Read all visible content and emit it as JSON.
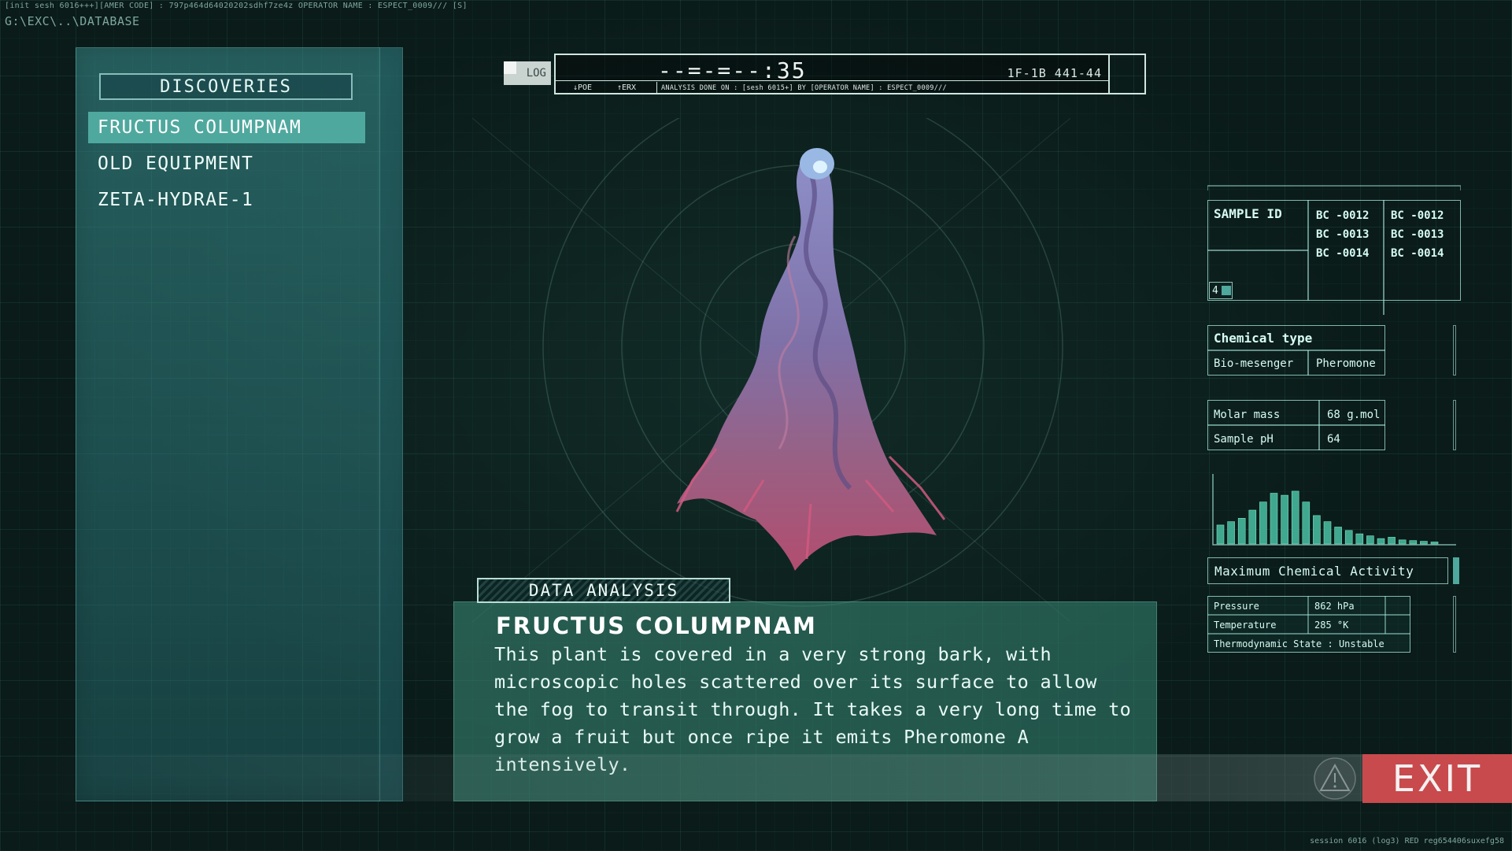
{
  "header": {
    "status_line": "[init sesh 6016+++][AMER CODE] : 797p464d64020202sdhf7ze4z  OPERATOR NAME : ESPECT_0009/// [S]",
    "path": "G:\\EXC\\..\\DATABASE"
  },
  "sidebar": {
    "title": "DISCOVERIES",
    "items": [
      {
        "label": "FRUCTUS COLUMPNAM",
        "selected": true
      },
      {
        "label": "OLD EQUIPMENT",
        "selected": false
      },
      {
        "label": "ZETA-HYDRAE-1",
        "selected": false
      }
    ]
  },
  "log": {
    "tab": "LOG",
    "counter": "--=-=--:35",
    "code": "1F-1B 441-44",
    "poe": "↓POE",
    "erx": "↑ERX",
    "analysis": "ANALYSIS DONE ON : [sesh 6015+] BY [OPERATOR NAME] : ESPECT_0009///"
  },
  "analysis": {
    "tab": "DATA ANALYSIS",
    "title": "FRUCTUS COLUMPNAM",
    "text": "This plant is covered in a very strong bark, with microscopic holes scattered over its surface to allow the fog to transit through. It takes a very long time to grow a fruit but once ripe it emits Pheromone A intensively."
  },
  "right_panel": {
    "sample_label": "SAMPLE ID",
    "sample_ids_col1": [
      "BC -0012",
      "BC -0013",
      "BC -0014"
    ],
    "sample_ids_col2": [
      "BC -0012",
      "BC -0013",
      "BC -0014"
    ],
    "sample_count": "4",
    "chemical_title": "Chemical type",
    "chemical_values": [
      "Bio-mesenger",
      "Pheromone"
    ],
    "molar_label": "Molar mass",
    "molar_value": "68 g.mol",
    "ph_label": "Sample pH",
    "ph_value": "64",
    "histogram": [
      0.28,
      0.33,
      0.38,
      0.5,
      0.62,
      0.75,
      0.72,
      0.78,
      0.62,
      0.42,
      0.33,
      0.25,
      0.2,
      0.15,
      0.12,
      0.08,
      0.1,
      0.06,
      0.05,
      0.04,
      0.03
    ],
    "max_activity": "Maximum Chemical Activity",
    "pressure_label": "Pressure",
    "pressure_value": "862 hPa",
    "temperature_label": "Temperature",
    "temperature_value": "285 °K",
    "thermo_state": "Thermodynamic State : Unstable"
  },
  "footer": {
    "exit": "EXIT",
    "session": "session 6016 (log3) RED reg654406suxefg58"
  },
  "colors": {
    "accent": "#4fa89e",
    "exit": "#c84a4d",
    "text": "#d6fbf2"
  }
}
